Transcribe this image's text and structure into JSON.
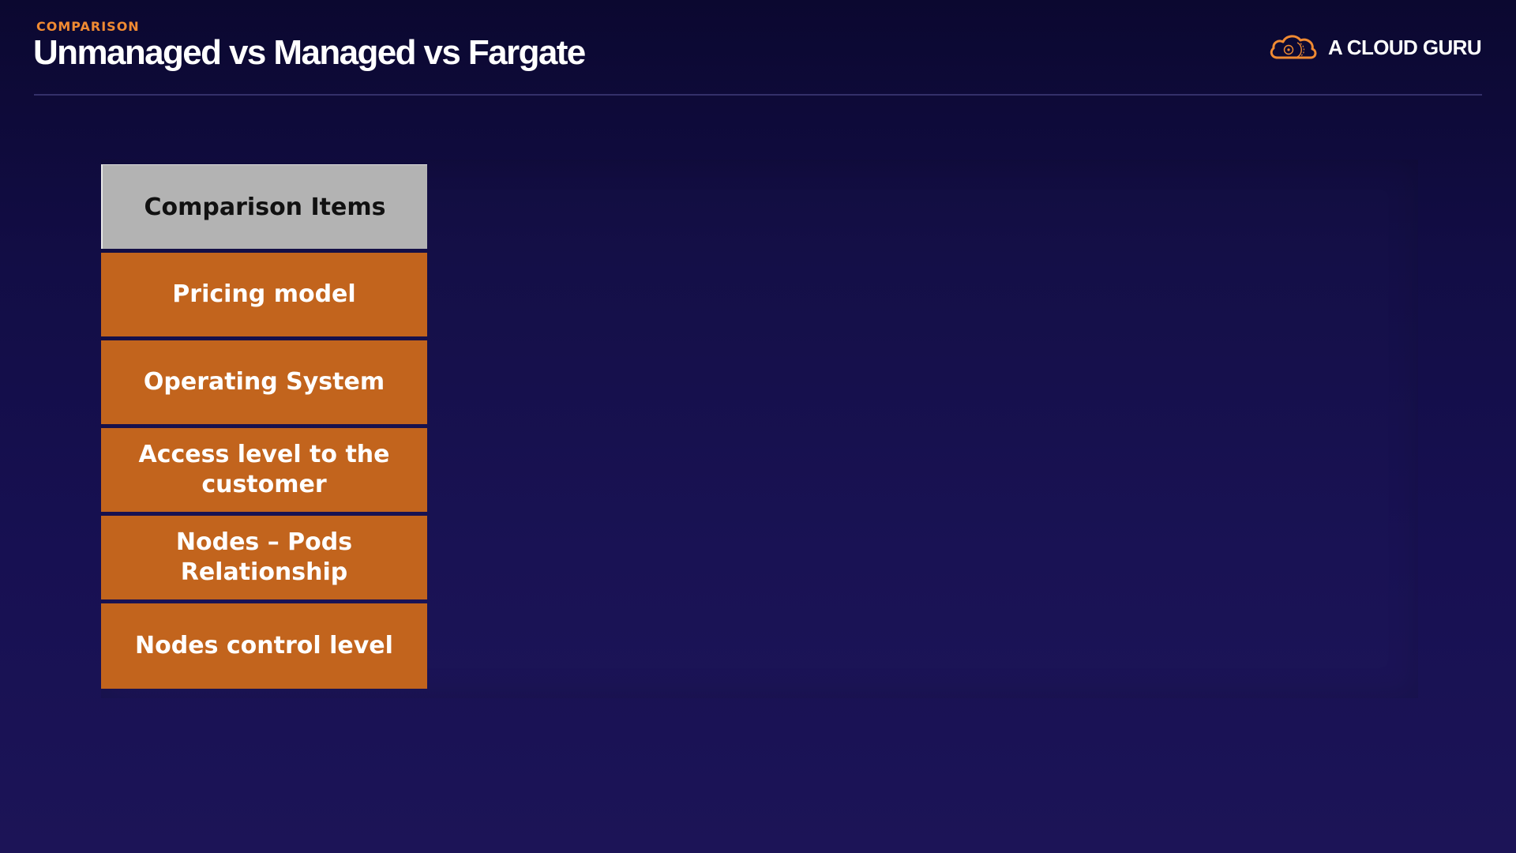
{
  "header": {
    "eyebrow": "COMPARISON",
    "title": "Unmanaged vs Managed vs Fargate"
  },
  "brand": {
    "logo_icon": "cloud-logo-icon",
    "name": "A CLOUD GURU"
  },
  "table": {
    "header_label": "Comparison Items",
    "items": [
      "Pricing model",
      "Operating System",
      "Access level to the customer",
      "Nodes – Pods Relationship",
      "Nodes control level"
    ]
  },
  "colors": {
    "background_top": "#0b0830",
    "background_bottom": "#1c1457",
    "accent": "#f08a32",
    "header_cell": "#b3b3b3",
    "item_cell": "#c2641d",
    "divider": "#34306a"
  }
}
